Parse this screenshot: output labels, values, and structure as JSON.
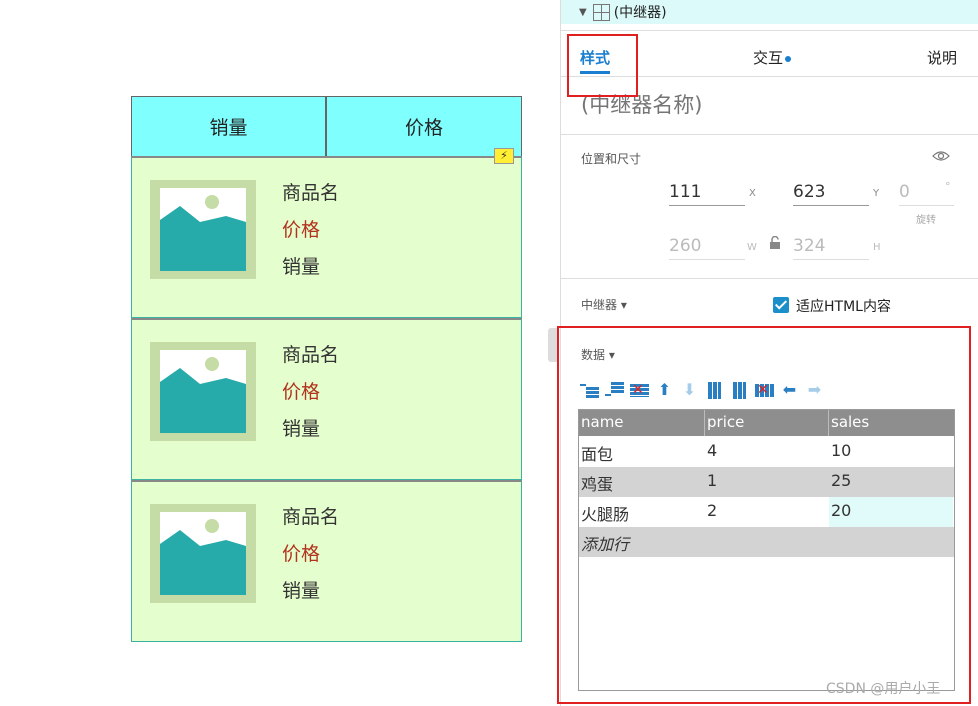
{
  "canvas": {
    "header": {
      "sales_label": "销量",
      "price_label": "价格"
    },
    "items": [
      {
        "name": "商品名",
        "price": "价格",
        "sales": "销量"
      },
      {
        "name": "商品名",
        "price": "价格",
        "sales": "销量"
      },
      {
        "name": "商品名",
        "price": "价格",
        "sales": "销量"
      }
    ]
  },
  "panel": {
    "widget_title": "(中继器)",
    "tabs": {
      "style": "样式",
      "interactions": "交互",
      "notes": "说明"
    },
    "name_placeholder": "(中继器名称)",
    "position_size": {
      "label": "位置和尺寸",
      "x": "111",
      "x_axis": "X",
      "y": "623",
      "y_axis": "Y",
      "rotation": "0",
      "rotation_unit": "°",
      "rotation_label": "旋转",
      "w": "260",
      "w_axis": "W",
      "h": "324",
      "h_axis": "H"
    },
    "repeater": {
      "label": "中继器 ▾",
      "fit_html_label": "适应HTML内容",
      "fit_html_checked": true
    },
    "data": {
      "label": "数据 ▾",
      "columns": [
        "name",
        "price",
        "sales"
      ],
      "rows": [
        [
          "面包",
          "4",
          "10"
        ],
        [
          "鸡蛋",
          "1",
          "25"
        ],
        [
          "火腿肠",
          "2",
          "20"
        ]
      ],
      "add_row_label": "添加行"
    }
  },
  "watermark": "CSDN @用户小王",
  "colors": {
    "header_bg": "#80ffff",
    "item_bg": "#e4fecd",
    "price_text": "#b3321e",
    "accent": "#1a7fd0",
    "highlight_box": "#e02020"
  }
}
